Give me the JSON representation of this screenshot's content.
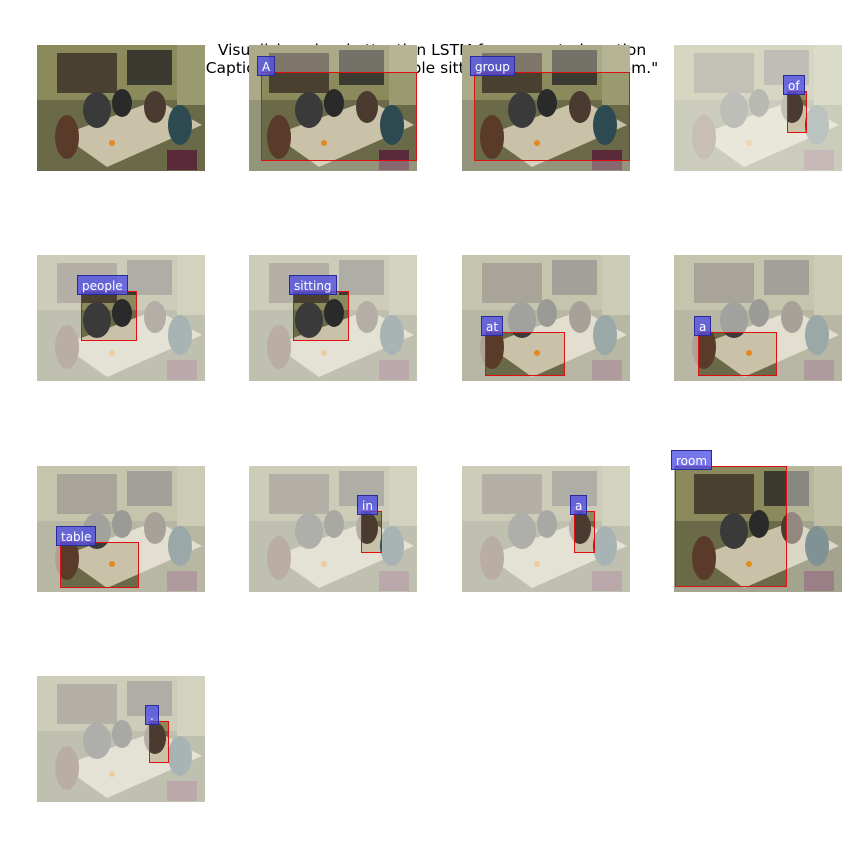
{
  "title": "Visualizing visual attention LSTM for generated caption",
  "caption": "Caption 0, \"A group of people sitting at a table in a room.\"",
  "colors": {
    "box": "#e01010",
    "label_bg": "#5050e6",
    "label_text": "#ffffff"
  },
  "words": [
    "A",
    "group",
    "of",
    "people",
    "sitting",
    "at",
    "a",
    "table",
    "in",
    "a",
    "room",
    "."
  ]
}
